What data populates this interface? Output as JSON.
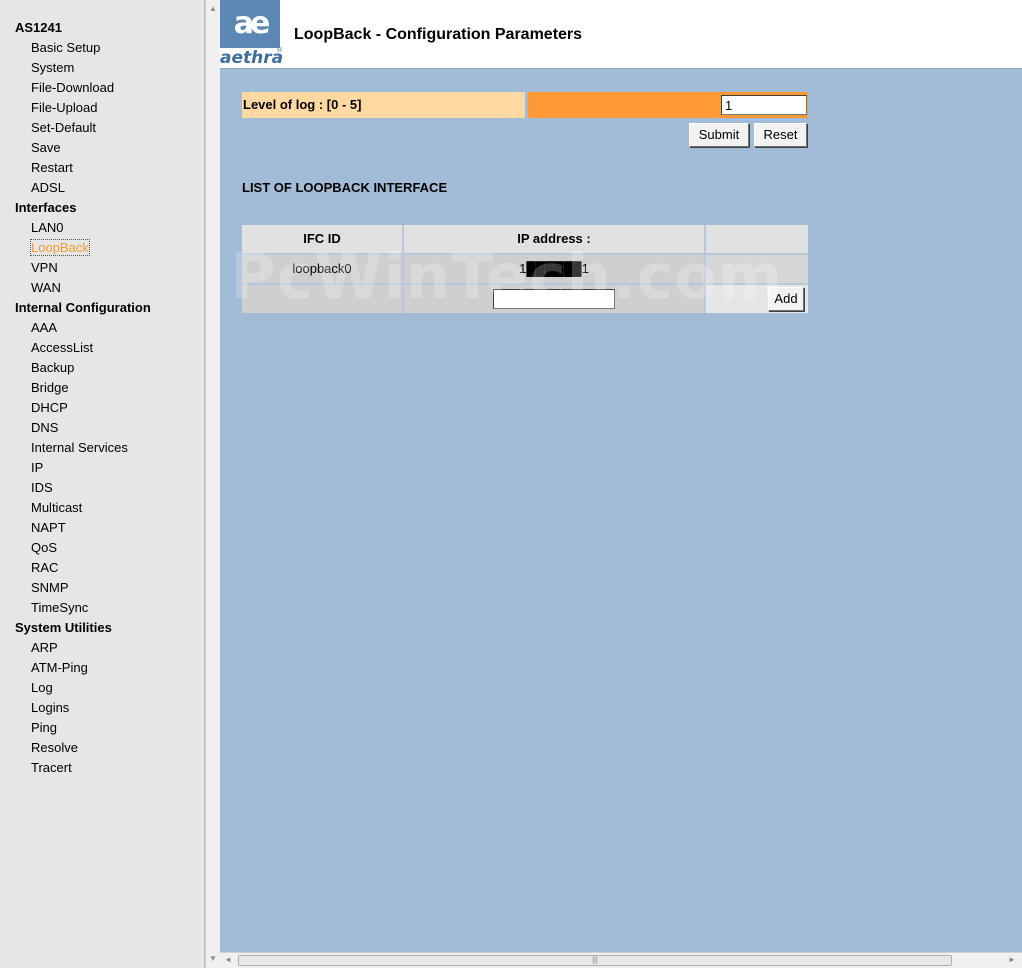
{
  "nav": {
    "groups": [
      {
        "title": "AS1241",
        "items": [
          "Basic Setup",
          "System",
          "File-Download",
          "File-Upload",
          "Set-Default",
          "Save",
          "Restart",
          "ADSL"
        ]
      },
      {
        "title": "Interfaces",
        "items": [
          "LAN0",
          "LoopBack",
          "VPN",
          "WAN"
        ]
      },
      {
        "title": "Internal Configuration",
        "items": [
          "AAA",
          "AccessList",
          "Backup",
          "Bridge",
          "DHCP",
          "DNS",
          "Internal Services",
          "IP",
          "IDS",
          "Multicast",
          "NAPT",
          "QoS",
          "RAC",
          "SNMP",
          "TimeSync"
        ]
      },
      {
        "title": "System Utilities",
        "items": [
          "ARP",
          "ATM-Ping",
          "Log",
          "Logins",
          "Ping",
          "Resolve",
          "Tracert"
        ]
      }
    ],
    "active_item": "LoopBack"
  },
  "header": {
    "logo_mark": "ae",
    "logo_word": "aethra",
    "logo_reg": "®",
    "title": "LoopBack - Configuration Parameters"
  },
  "log_level": {
    "label": "Level of log : [0 - 5]",
    "value": "1",
    "submit_label": "Submit",
    "reset_label": "Reset"
  },
  "loopback_list": {
    "title": "LIST OF LOOPBACK INTERFACE",
    "columns": [
      "IFC ID",
      "IP address :",
      ""
    ],
    "rows": [
      {
        "ifc_id": "loopback0",
        "ip_address": "1██████1"
      }
    ],
    "new_ip_value": "",
    "add_label": "Add"
  },
  "watermark": "PcWinTech.com",
  "colors": {
    "nav_bg": "#e6e6e6",
    "main_bg": "#a2bcd7",
    "label_bg": "#ffd9a0",
    "field_bg": "#ff9933",
    "active_link": "#f39a2e",
    "logo_blue": "#5b87b4"
  }
}
